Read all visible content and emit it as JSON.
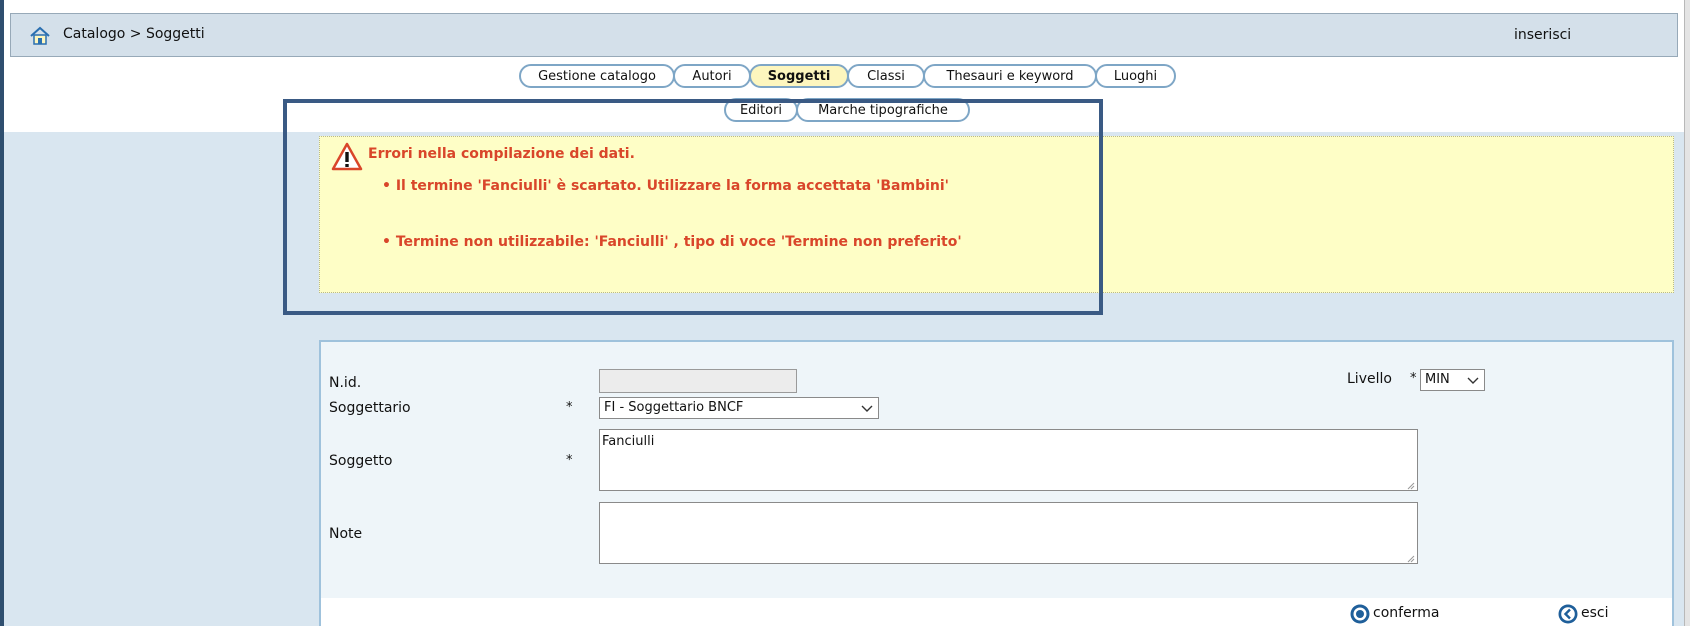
{
  "header": {
    "breadcrumb": "Catalogo > Soggetti",
    "action_label": "inserisci"
  },
  "tabs": [
    {
      "label": "Gestione catalogo",
      "active": false
    },
    {
      "label": "Autori",
      "active": false
    },
    {
      "label": "Soggetti",
      "active": true
    },
    {
      "label": "Classi",
      "active": false
    },
    {
      "label": "Thesauri e keyword",
      "active": false
    },
    {
      "label": "Luoghi",
      "active": false
    }
  ],
  "subtabs": [
    {
      "label": "Editori"
    },
    {
      "label": "Marche tipografiche"
    }
  ],
  "errors": {
    "title": "Errori nella compilazione dei dati.",
    "items": [
      "• Il termine 'Fanciulli' è scartato. Utilizzare la forma accettata 'Bambini'",
      "• Termine non utilizzabile: 'Fanciulli' , tipo di voce 'Termine non preferito'"
    ]
  },
  "form": {
    "nid_label": "N.id.",
    "nid_value": "",
    "livello_label": "Livello",
    "livello_value": "MIN",
    "soggettario_label": "Soggettario",
    "soggettario_value": "FI - Soggettario BNCF",
    "soggetto_label": "Soggetto",
    "soggetto_value": "Fanciulli",
    "note_label": "Note",
    "note_value": "",
    "required_mark": "*"
  },
  "buttons": {
    "confirm_label": "conferma",
    "exit_label": "esci"
  },
  "colors": {
    "header_bg": "#d4e0ea",
    "content_bg": "#d9e6f0",
    "error_bg": "#fefec6",
    "error_text": "#d9462a",
    "tab_border": "#7ea6c6",
    "active_tab_bg": "#fdf6be",
    "highlight_border": "#3a5a84"
  }
}
